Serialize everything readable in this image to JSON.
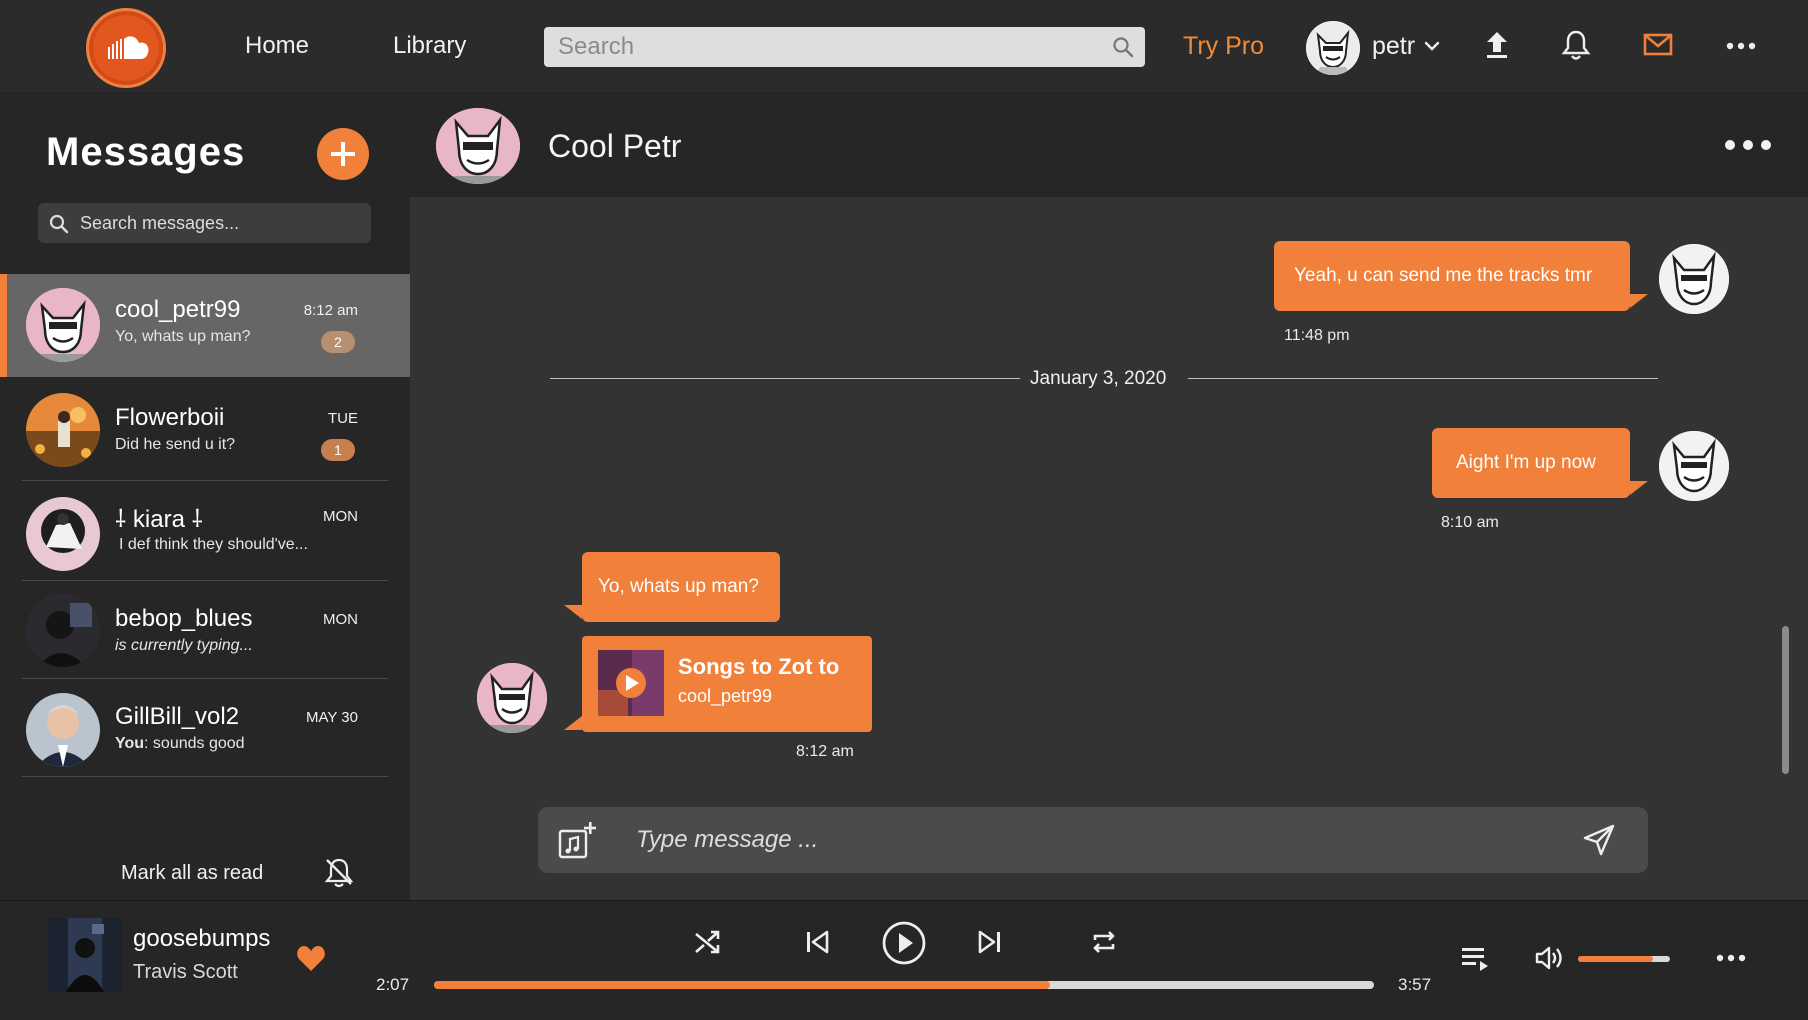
{
  "nav": {
    "home": "Home",
    "library": "Library",
    "search_placeholder": "Search",
    "try_pro": "Try Pro",
    "username": "petr"
  },
  "sidebar": {
    "title": "Messages",
    "search_placeholder": "Search messages...",
    "conversations": [
      {
        "name": "cool_petr99",
        "preview": "Yo, whats up man?",
        "time": "8:12 am",
        "badge": "2",
        "active": true
      },
      {
        "name": "Flowerboii",
        "preview": "Did he send u it?",
        "time": "TUE",
        "badge": "1"
      },
      {
        "name": "⸸ kiara ⸸",
        "preview": "I def think they should've...",
        "time": "MON"
      },
      {
        "name": "bebop_blues",
        "preview": "is currently typing...",
        "time": "MON"
      },
      {
        "name": "GillBill_vol2",
        "preview_prefix": "You",
        "preview": ": sounds good",
        "time": "MAY 30"
      }
    ],
    "mark_all_read": "Mark all as read"
  },
  "chat": {
    "contact_name": "Cool Petr",
    "messages": [
      {
        "text": "Yeah, u can send me the tracks tmr",
        "time": "11:48 pm",
        "from": "me"
      },
      {
        "text": "Aight I'm up now",
        "time": "8:10 am",
        "from": "me"
      },
      {
        "text": "Yo, whats up man?",
        "from": "them"
      }
    ],
    "date_separator": "January 3, 2020",
    "shared_track": {
      "title": "Songs to Zot to",
      "user": "cool_petr99",
      "time": "8:12 am"
    },
    "composer_placeholder": "Type message ..."
  },
  "player": {
    "title": "goosebumps",
    "artist": "Travis Scott",
    "elapsed": "2:07",
    "duration": "3:57",
    "progress": 0.655,
    "volume": 0.82,
    "liked": true
  },
  "colors": {
    "accent": "#f0803a",
    "bg_dark": "#262626",
    "bg_chat": "#333333",
    "active_row": "#666666"
  }
}
